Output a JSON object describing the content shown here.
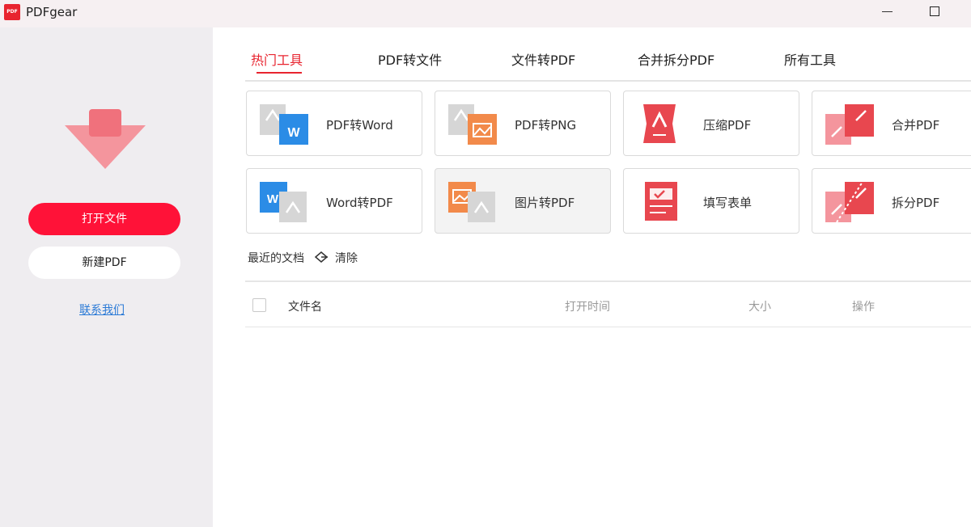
{
  "app": {
    "logo_text": "PDF",
    "title": "PDFgear"
  },
  "sidebar": {
    "open_button": "打开文件",
    "new_button": "新建PDF",
    "contact_link": "联系我们"
  },
  "tabs": [
    {
      "label": "热门工具",
      "active": true
    },
    {
      "label": "PDF转文件",
      "active": false
    },
    {
      "label": "文件转PDF",
      "active": false
    },
    {
      "label": "合并拆分PDF",
      "active": false
    },
    {
      "label": "所有工具",
      "active": false
    }
  ],
  "tools": [
    {
      "label": "PDF转Word",
      "icon": "pdf-to-word-icon"
    },
    {
      "label": "PDF转PNG",
      "icon": "pdf-to-png-icon"
    },
    {
      "label": "压缩PDF",
      "icon": "compress-pdf-icon"
    },
    {
      "label": "合并PDF",
      "icon": "merge-pdf-icon"
    },
    {
      "label": "Word转PDF",
      "icon": "word-to-pdf-icon"
    },
    {
      "label": "图片转PDF",
      "icon": "image-to-pdf-icon"
    },
    {
      "label": "填写表单",
      "icon": "fill-form-icon"
    },
    {
      "label": "拆分PDF",
      "icon": "split-pdf-icon"
    }
  ],
  "recent": {
    "title": "最近的文档",
    "clear_label": "清除",
    "columns": {
      "name": "文件名",
      "time": "打开时间",
      "size": "大小",
      "ops": "操作"
    },
    "rows": []
  },
  "colors": {
    "accent": "#ff1238",
    "red_icon": "#e8474f",
    "word_blue": "#2b8ce6",
    "png_orange": "#f28a4a",
    "gray_doc": "#d3d3d3",
    "link": "#2b7ad6"
  }
}
